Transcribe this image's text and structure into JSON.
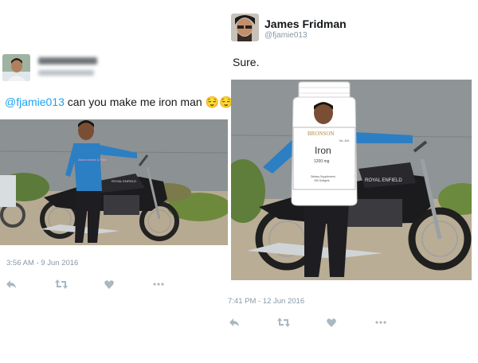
{
  "left_tweet": {
    "handle_prefix": "@",
    "mention": "@fjamie013",
    "text": " can you make  me iron man ",
    "emoji": [
      "😌",
      "😌"
    ],
    "timestamp": "3:56 AM - 9 Jun 2016"
  },
  "right_tweet": {
    "name": "James Fridman",
    "handle": "@fjamie013",
    "text": "Sure.",
    "timestamp": "7:41 PM - 12 Jun 2016"
  },
  "bottle_label": {
    "brand": "BRONSON",
    "number": "No. 404",
    "title": "Iron",
    "dose": "1200 mg",
    "desc_line1": "Dietary Supplement",
    "desc_line2": "250 Softgels"
  },
  "bike_labels": {
    "left": "ROYAL ENFIELD",
    "right": "ROYAL ENFIELD"
  },
  "shirt_text": "Abercrombie & Fitch",
  "icons": [
    "reply-icon",
    "retweet-icon",
    "like-icon",
    "more-icon"
  ],
  "colors": {
    "link": "#1da1f2",
    "meta": "#8899a6",
    "icon": "#aab8c2"
  }
}
